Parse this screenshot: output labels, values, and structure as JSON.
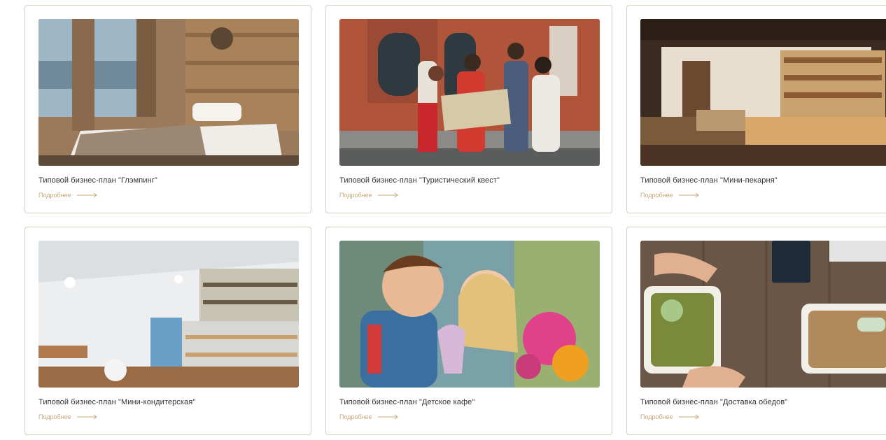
{
  "colors": {
    "border": "#d8cfc0",
    "link": "#c9a97c",
    "text": "#333333"
  },
  "cards": [
    {
      "title": "Типовой бизнес-план \"Глэмпинг\"",
      "more": "Подробнее"
    },
    {
      "title": "Типовой бизнес-план \"Туристический квест\"",
      "more": "Подробнее"
    },
    {
      "title": "Типовой бизнес-план \"Мини-пекарня\"",
      "more": "Подробнее"
    },
    {
      "title": "Типовой бизнес-план \"Мини-кондитерская\"",
      "more": "Подробнее"
    },
    {
      "title": "Типовой бизнес-план \"Детское кафе\"",
      "more": "Подробнее"
    },
    {
      "title": "Типовой бизнес-план \"Доставка обедов\"",
      "more": "Подробнее"
    }
  ]
}
